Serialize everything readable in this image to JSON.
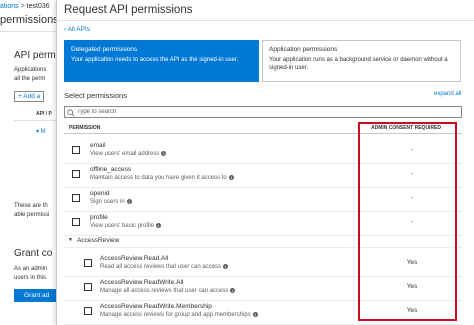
{
  "background_portal": {
    "breadcrumb_link": "ations",
    "breadcrumb_sep": " > ",
    "breadcrumb_tail": "test036",
    "page_title": "permissions",
    "section1_title": "API perm",
    "section1_desc": [
      "Applications",
      "all the perm"
    ],
    "add_button": "+ Add a",
    "column_header": "API / P",
    "expander": "▾ M",
    "section1_footer": [
      "These are th",
      "able permissi"
    ],
    "section2_title": "Grant co",
    "section2_desc": [
      "As an admin",
      "users in this"
    ],
    "grant_button": "Grant ad"
  },
  "dialog": {
    "title": "Request API permissions",
    "back_link": "‹ All APIs",
    "cards": [
      {
        "title": "Delegated permissions",
        "desc": "Your application needs to access the API as the signed-in user.",
        "selected": true
      },
      {
        "title": "Application permissions",
        "desc": "Your application runs as a background service or daemon without a signed-in user.",
        "selected": false
      }
    ],
    "select_label": "Select permissions",
    "expand_all": "expand all",
    "search_placeholder": "Type to search",
    "headers": {
      "permission": "PERMISSION",
      "admin_consent": "ADMIN CONSENT REQUIRED"
    },
    "rows": [
      {
        "name": "email",
        "desc": "View users' email address",
        "admin": "-"
      },
      {
        "name": "offline_access",
        "desc": "Maintain access to data you have given it access to",
        "admin": "-"
      },
      {
        "name": "openid",
        "desc": "Sign users in",
        "admin": "-"
      },
      {
        "name": "profile",
        "desc": "View users' basic profile",
        "admin": "-"
      }
    ],
    "group": {
      "name": "AccessReview",
      "chevron": "▼"
    },
    "group_rows": [
      {
        "name": "AccessReview.Read.All",
        "desc": "Read all access reviews that user can access",
        "admin": "Yes"
      },
      {
        "name": "AccessReview.ReadWrite.All",
        "desc": "Manage all access reviews that user can access",
        "admin": "Yes"
      },
      {
        "name": "AccessReview.ReadWrite.Membership",
        "desc": "Manage access reviews for group and app memberships",
        "admin": "Yes"
      }
    ],
    "info_glyph": "i"
  },
  "colors": {
    "accent": "#0078d4",
    "highlight": "#c50f1f"
  }
}
